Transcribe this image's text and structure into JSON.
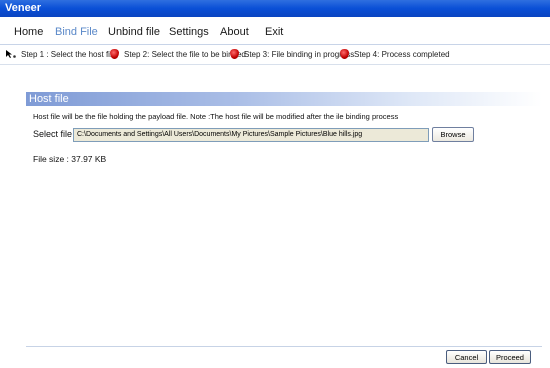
{
  "window": {
    "title": "Veneer"
  },
  "menu": {
    "items": [
      {
        "label": "Home"
      },
      {
        "label": "Bind File"
      },
      {
        "label": "Unbind file"
      },
      {
        "label": "Settings"
      },
      {
        "label": "About"
      },
      {
        "label": "Exit"
      }
    ],
    "active": "Bind File"
  },
  "steps": [
    {
      "label": "Step 1 : Select the host file",
      "icon": "arrow-cursor-icon"
    },
    {
      "label": "Step 2: Select the file to be binded",
      "icon": "red-shield-icon"
    },
    {
      "label": "Step 3: File binding in progress",
      "icon": "red-shield-icon"
    },
    {
      "label": "Step 4: Process completed",
      "icon": "red-shield-icon"
    }
  ],
  "host_file": {
    "header": "Host file",
    "description": "Host file will be the file holding the payload file. Note :The host file will be modified after the ile binding process",
    "select_label": "Select file :",
    "path_value": "C:\\Documents and Settings\\All Users\\Documents\\My Pictures\\Sample Pictures\\Blue hills.jpg",
    "browse_label": "Browse",
    "file_size": "File size : 37.97 KB"
  },
  "footer": {
    "cancel_label": "Cancel",
    "proceed_label": "Proceed"
  },
  "colors": {
    "titlebar": "#0a4fd6",
    "active_menu": "#5a88c8",
    "section_header": "#7f9bd6",
    "step_shield": "#c00000"
  }
}
